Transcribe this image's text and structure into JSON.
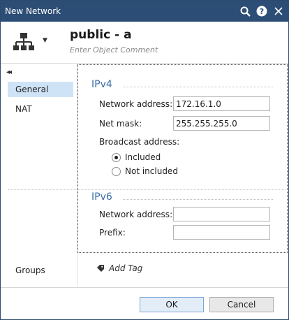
{
  "window": {
    "title": "New Network"
  },
  "titlebar": {
    "search_icon": "search-icon",
    "help_icon": "help-icon",
    "close_icon": "close-icon"
  },
  "header": {
    "object_icon": "network-icon",
    "name": "public - a",
    "comment_placeholder": "Enter Object Comment"
  },
  "sidebar": {
    "collapse_icon": "double-chevron-left-icon",
    "items": [
      {
        "label": "General",
        "active": true
      },
      {
        "label": "NAT",
        "active": false
      }
    ],
    "groups_label": "Groups",
    "add_tag_label": "Add Tag"
  },
  "ipv4": {
    "title": "IPv4",
    "network_address_label": "Network address:",
    "network_address_value": "172.16.1.0",
    "net_mask_label": "Net mask:",
    "net_mask_value": "255.255.255.0",
    "broadcast_label": "Broadcast address:",
    "broadcast_options": [
      {
        "label": "Included",
        "selected": true
      },
      {
        "label": "Not included",
        "selected": false
      }
    ]
  },
  "ipv6": {
    "title": "IPv6",
    "network_address_label": "Network address:",
    "network_address_value": "",
    "prefix_label": "Prefix:",
    "prefix_value": ""
  },
  "footer": {
    "ok_label": "OK",
    "cancel_label": "Cancel"
  },
  "colors": {
    "titlebar": "#2c4d76",
    "accent": "#3a6ea8",
    "selected_nav": "#cfe3f7"
  }
}
